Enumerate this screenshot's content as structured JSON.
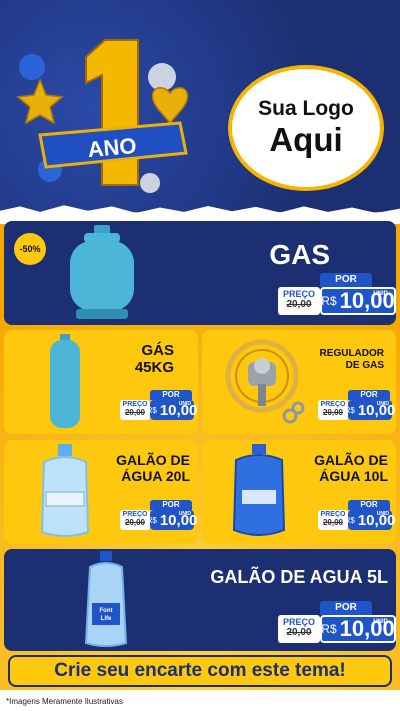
{
  "header": {
    "anniversary_number": "1",
    "anniversary_word": "ANO",
    "logo_line1": "Sua Logo",
    "logo_line2": "Aqui"
  },
  "products": [
    {
      "name": "GAS",
      "old_price": "20,00",
      "price": "10,00",
      "badge": "-50%"
    },
    {
      "name_line1": "GÁS",
      "name_line2": "45KG",
      "old_price": "20,00",
      "price": "10,00"
    },
    {
      "name_line1": "REGULADOR",
      "name_line2": "DE GAS",
      "old_price": "20,00",
      "price": "10,00"
    },
    {
      "name_line1": "GALÃO DE",
      "name_line2": "ÁGUA 20L",
      "old_price": "20,00",
      "price": "10,00"
    },
    {
      "name_line1": "GALÃO DE",
      "name_line2": "ÁGUA 10L",
      "old_price": "20,00",
      "price": "10,00"
    },
    {
      "name": "GALÃO DE AGUA 5L",
      "old_price": "20,00",
      "price": "10,00"
    }
  ],
  "price_labels": {
    "por": "POR",
    "preco": "PREÇO",
    "currency": "R$",
    "unit": "UNID"
  },
  "bottle_brand": {
    "line1": "Font",
    "line2": "Life"
  },
  "banner_text": "Crie seu encarte com este tema!",
  "disclaimer": "*Imagens Meramente Ilustrativas",
  "colors": {
    "navy": "#1b2f72",
    "yellow": "#fdc80e",
    "price_blue": "#1f55c9"
  }
}
